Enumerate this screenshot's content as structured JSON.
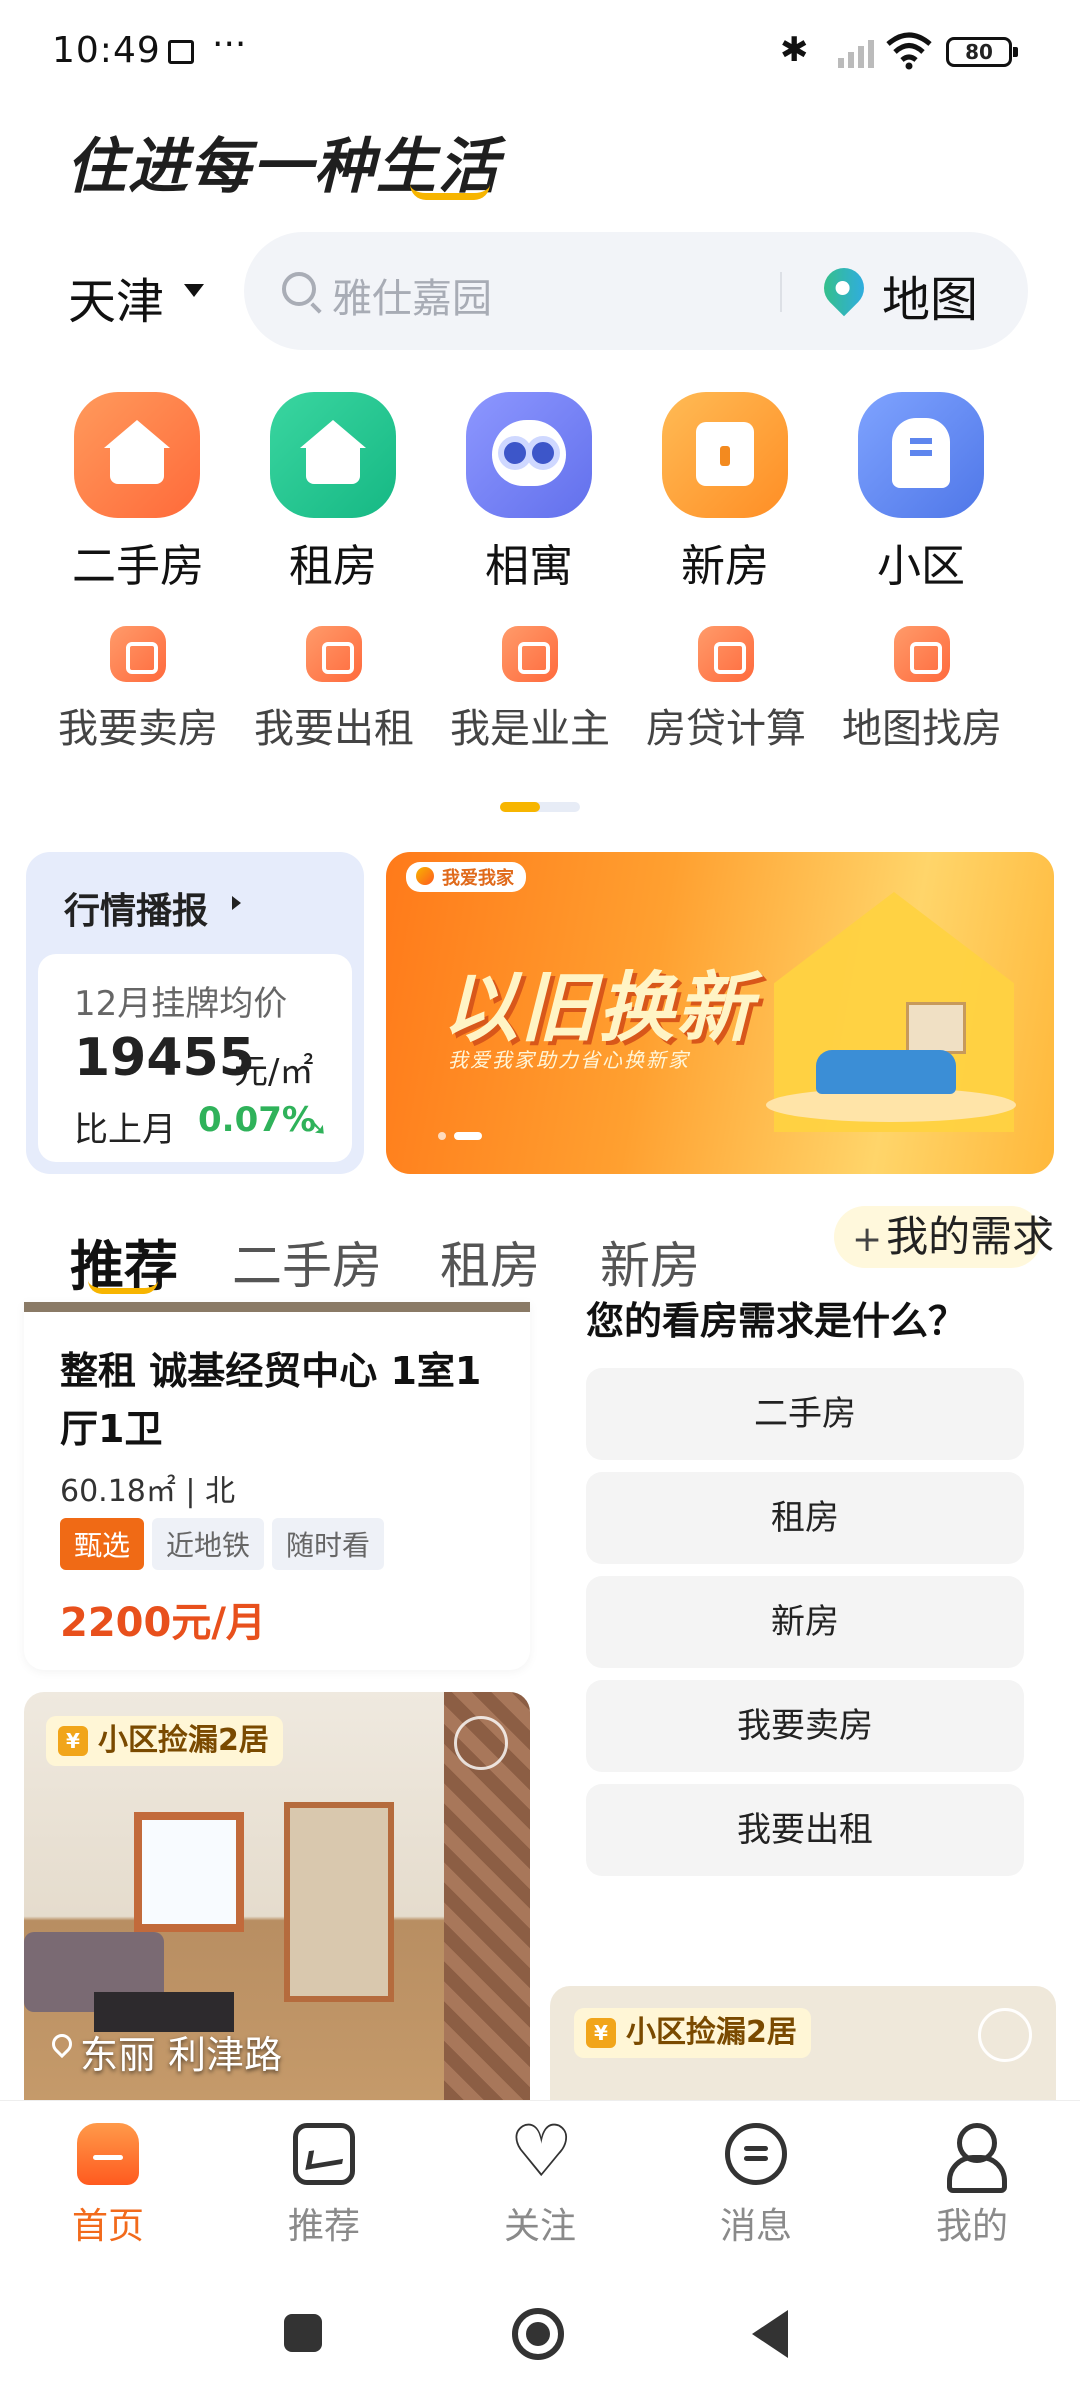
{
  "status_bar": {
    "time": "10:49",
    "more": "···",
    "battery": "80"
  },
  "slogan": "住进每一种生活",
  "header": {
    "city": "天津",
    "search_placeholder": "雅仕嘉园",
    "map_label": "地图"
  },
  "categories": [
    {
      "label": "二手房",
      "icon": "house-check-icon",
      "color": "#ff7a45"
    },
    {
      "label": "租房",
      "icon": "house-lock-icon",
      "color": "#23c48f"
    },
    {
      "label": "相寓",
      "icon": "owl-mascot-icon",
      "color": "#6f7df3"
    },
    {
      "label": "新房",
      "icon": "door-sparkle-icon",
      "color": "#ffa040"
    },
    {
      "label": "小区",
      "icon": "building-icon",
      "color": "#5e86ee"
    }
  ],
  "subcategories": [
    {
      "label": "我要卖房",
      "icon": "tag-icon"
    },
    {
      "label": "我要出租",
      "icon": "percent-tag-icon"
    },
    {
      "label": "我是业主",
      "icon": "owner-icon"
    },
    {
      "label": "房贷计算",
      "icon": "calculator-icon"
    },
    {
      "label": "地图找房",
      "icon": "map-icon"
    }
  ],
  "market": {
    "title": "行情播报",
    "label": "12月挂牌均价",
    "price": "19455",
    "unit": "元/㎡",
    "compare_label": "比上月",
    "change": "0.07%"
  },
  "banner": {
    "brand": "我爱我家",
    "headline": "以旧换新",
    "subline": "我爱我家助力省心换新家"
  },
  "tabs": [
    "推荐",
    "二手房",
    "租房",
    "新房"
  ],
  "needs_button": "我的需求",
  "listing": {
    "title": "整租 诚基经贸中心 1室1厅1卫",
    "meta": "60.18㎡ | 北",
    "tags": [
      "甄选",
      "近地铁",
      "随时看"
    ],
    "price": "2200元/月"
  },
  "photo_card": {
    "tag": "小区捡漏2居",
    "location": "东丽 利津路"
  },
  "needs_panel": {
    "question": "您的看房需求是什么？",
    "options": [
      "二手房",
      "租房",
      "新房",
      "我要卖房",
      "我要出租"
    ]
  },
  "card2": {
    "tag": "小区捡漏2居"
  },
  "bottom_nav": [
    {
      "label": "首页",
      "active": true
    },
    {
      "label": "推荐",
      "active": false
    },
    {
      "label": "关注",
      "active": false
    },
    {
      "label": "消息",
      "active": false
    },
    {
      "label": "我的",
      "active": false
    }
  ]
}
